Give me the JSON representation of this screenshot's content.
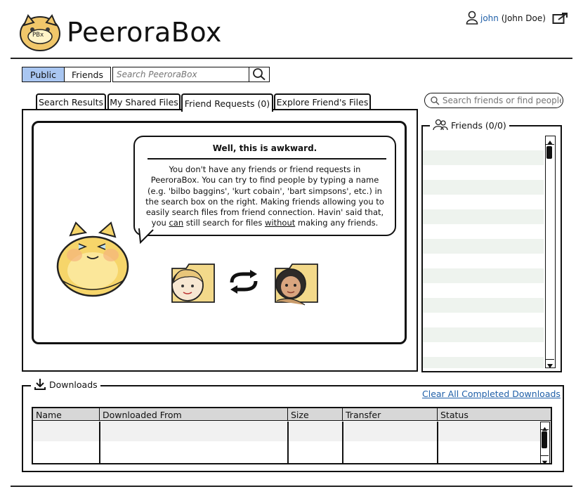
{
  "app": {
    "logo_badge": "PBx",
    "title": "PeeroraBox"
  },
  "user": {
    "username": "john",
    "full_name": "(John Doe)"
  },
  "scope": {
    "public_label": "Public",
    "friends_label": "Friends",
    "search_placeholder": "Search PeeroraBox",
    "active": "Public"
  },
  "tabs": [
    {
      "label": "Search Results"
    },
    {
      "label": "My Shared Files"
    },
    {
      "label": "Friend Requests (0)"
    },
    {
      "label": "Explore Friend's Files"
    }
  ],
  "friend_search": {
    "placeholder": "Search friends or find people"
  },
  "message": {
    "title": "Well, this is awkward.",
    "line1": "You don't have any friends or friend requests in",
    "line2": "PeeroraBox. You can try to find people by typing a name",
    "line3": "(e.g. 'bilbo baggins', 'kurt cobain', 'bart simpsons', etc.) in",
    "line4": "the search box on the right. Making friends allowing you to",
    "line5": "easily search files from friend connection. Havin' said that,",
    "line6_pre": "you ",
    "line6_can": "can",
    "line6_mid": " still search for files ",
    "line6_without": "without",
    "line6_post": " making any friends."
  },
  "friends_panel": {
    "label": "Friends (0/0)"
  },
  "downloads": {
    "label": "Downloads",
    "clear_label": "Clear All Completed Downloads",
    "columns": [
      "Name",
      "Downloaded From",
      "Size",
      "Transfer",
      "Status"
    ]
  },
  "colors": {
    "active_segment": "#a9c6f1",
    "link": "#1f5fa8",
    "table_header": "#d7d7d7"
  }
}
